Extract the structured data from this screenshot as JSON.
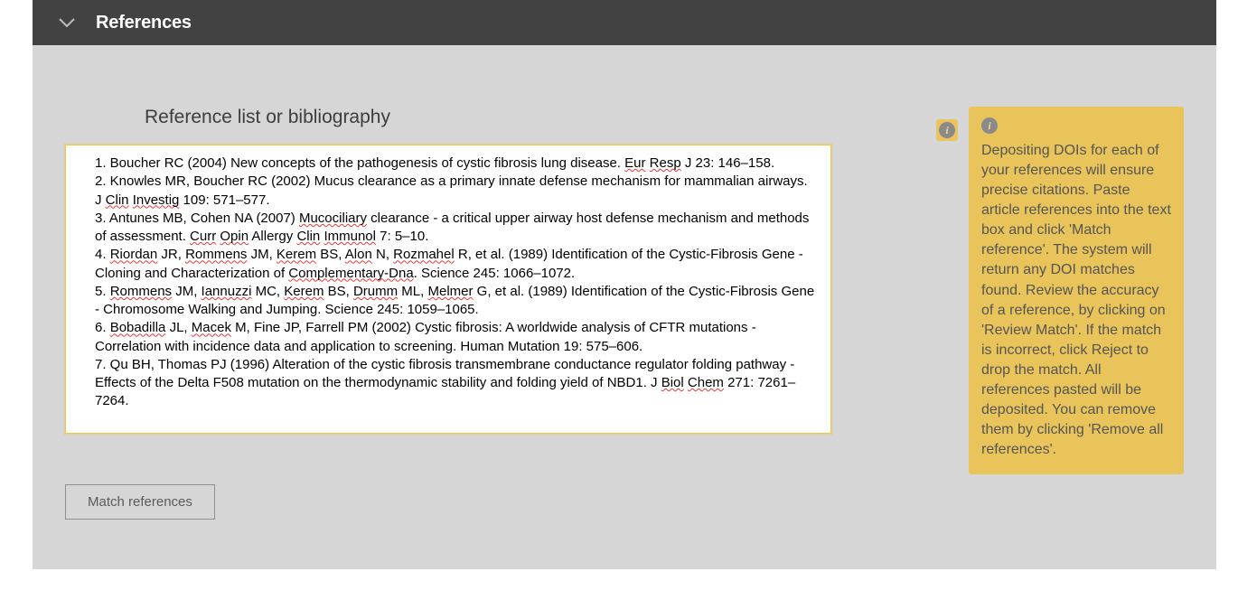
{
  "header": {
    "title": "References"
  },
  "main": {
    "subheading": "Reference list or bibliography",
    "matchButton": "Match references",
    "references": [
      {
        "n": "1",
        "pre": "Boucher RC (2004) New concepts of the pathogenesis of cystic fibrosis lung disease. ",
        "sp": [
          "Eur",
          " ",
          "Resp"
        ],
        "post": " J 23: 146–158."
      },
      {
        "n": "2",
        "pre": "Knowles MR, Boucher RC (2002) Mucus clearance as a primary innate defense mechanism for mammalian airways. J ",
        "sp": [
          "Clin",
          " ",
          "Investig"
        ],
        "post": " 109: 571–577."
      },
      {
        "n": "3",
        "pre": "Antunes MB, Cohen NA (2007) ",
        "sp": [
          "Mucociliary"
        ],
        "mid": " clearance - a critical upper airway host defense mechanism and methods of assessment. ",
        "sp2": [
          "Curr",
          " ",
          "Opin",
          " Allergy ",
          "Clin",
          " ",
          "Immunol"
        ],
        "post": " 7: 5–10."
      },
      {
        "n": "4",
        "pre": "",
        "sp": [
          "Riordan"
        ],
        "mid": " JR, ",
        "sp2": [
          "Rommens"
        ],
        "mid2": " JM, ",
        "sp3": [
          "Kerem"
        ],
        "mid3": " BS, ",
        "sp4": [
          "Alon"
        ],
        "mid4": " N, ",
        "sp5": [
          "Rozmahel"
        ],
        "mid5": " R, et al. (1989) Identification of the Cystic-Fibrosis Gene - Cloning and Characterization of ",
        "sp6": [
          "Complementary-Dna"
        ],
        "post": ". Science 245: 1066–1072."
      },
      {
        "n": "5",
        "pre": "",
        "sp": [
          "Rommens"
        ],
        "mid": " JM, ",
        "sp2": [
          "Iannuzzi"
        ],
        "mid2": " MC, ",
        "sp3": [
          "Kerem"
        ],
        "mid3": " BS, ",
        "sp4": [
          "Drumm"
        ],
        "mid4": " ML, ",
        "sp5": [
          "Melmer"
        ],
        "post": " G, et al. (1989) Identification of the Cystic-Fibrosis Gene - Chromosome Walking and Jumping. Science 245: 1059–1065."
      },
      {
        "n": "6",
        "pre": "",
        "sp": [
          "Bobadilla"
        ],
        "mid": " JL, ",
        "sp2": [
          "Macek"
        ],
        "post": " M, Fine JP, Farrell PM (2002) Cystic fibrosis: A worldwide analysis of CFTR mutations - Correlation with incidence data and application to screening. Human Mutation 19: 575–606."
      },
      {
        "n": "7",
        "pre": "Qu BH, Thomas PJ (1996) Alteration of the cystic fibrosis transmembrane conductance regulator folding pathway - Effects of the Delta F508 mutation on the thermodynamic stability and folding yield of NBD1. J ",
        "sp": [
          "Biol",
          " ",
          "Chem"
        ],
        "post": " 271: 7261–7264."
      }
    ]
  },
  "help": {
    "text": "Depositing DOIs for each of your references will ensure precise citations. Paste article references into the text box and click 'Match reference'. The system will return any DOI matches found. Review the accuracy of a reference, by clicking on 'Review Match'. If the match is incorrect, click Reject to drop the match. All references pasted will be deposited. You can remove them by clicking 'Remove all references'."
  }
}
